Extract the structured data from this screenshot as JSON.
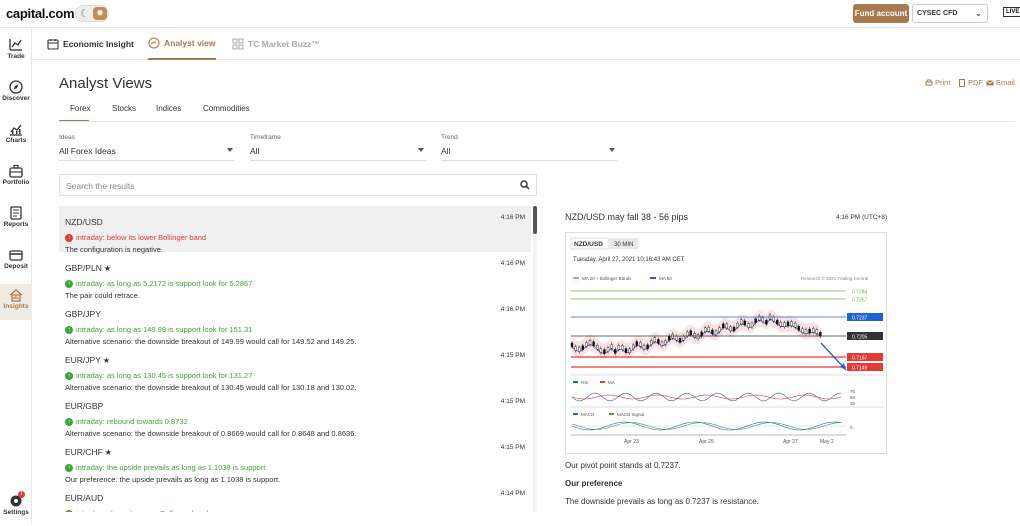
{
  "topbar": {
    "logo": "capital.com",
    "fund_button": "Fund account",
    "account": "CYSEC CFD",
    "live": "LIVE"
  },
  "sidebar": {
    "items": [
      {
        "label": "Trade",
        "icon": "trade-chart-icon"
      },
      {
        "label": "Discover",
        "icon": "compass-icon"
      },
      {
        "label": "Charts",
        "icon": "charts-icon"
      },
      {
        "label": "Portfolio",
        "icon": "briefcase-icon"
      },
      {
        "label": "Reports",
        "icon": "reports-icon"
      },
      {
        "label": "Deposit",
        "icon": "card-icon"
      },
      {
        "label": "Insights",
        "icon": "insights-icon"
      }
    ],
    "settings_label": "Settings",
    "settings_badge": "1"
  },
  "tabs": [
    {
      "label": "Economic Insight"
    },
    {
      "label": "Analyst view"
    },
    {
      "label": "TC Market Buzz™"
    }
  ],
  "page": {
    "title": "Analyst Views",
    "print": "Print",
    "pdf": "PDF",
    "email": "Email"
  },
  "subtabs": [
    "Forex",
    "Stocks",
    "Indices",
    "Commodities"
  ],
  "filters": [
    {
      "label": "Ideas",
      "value": "All Forex Ideas"
    },
    {
      "label": "Timeframe",
      "value": "All"
    },
    {
      "label": "Trend",
      "value": "All"
    }
  ],
  "search": {
    "placeholder": "Search the results"
  },
  "ideas": [
    {
      "pair": "NZD/USD",
      "star": "",
      "time": "4:16 PM",
      "dir": "down",
      "signal": "intraday: below its lower Bollinger band",
      "desc": "The configuration is negative."
    },
    {
      "pair": "GBP/PLN",
      "star": "★",
      "time": "4:16 PM",
      "dir": "up",
      "signal": "intraday: as long as 5.2172 is support look for 5.2867",
      "desc": "The pair could retrace."
    },
    {
      "pair": "GBP/JPY",
      "star": "",
      "time": "4:16 PM",
      "dir": "up",
      "signal": "intraday: as long as 149.99 is support look for 151.31",
      "desc": "Alternative scenario: the downside breakout of 149.99 would call for 149.52 and 149.25."
    },
    {
      "pair": "EUR/JPY",
      "star": "★",
      "time": "4:15 PM",
      "dir": "up",
      "signal": "intraday: as long as 130.45 is support look for 131.27",
      "desc": "Alternative scenario: the downside breakout of 130.45 would call for 130.18 and 130.02."
    },
    {
      "pair": "EUR/GBP",
      "star": "",
      "time": "4:15 PM",
      "dir": "up",
      "signal": "intraday: rebound towards 0.8732",
      "desc": "Alternative scenario: the downside breakout of 0.8669 would call for 0.8648 and 0.8636."
    },
    {
      "pair": "EUR/CHF",
      "star": "★",
      "time": "4:15 PM",
      "dir": "up",
      "signal": "intraday: the upside prevails as long as 1.1038 is support",
      "desc": "Our preference: the upside prevails as long as 1.1038 is support."
    },
    {
      "pair": "EUR/AUD",
      "star": "",
      "time": "4:14 PM",
      "dir": "up",
      "signal": "intraday: above its upper Bollinger band",
      "desc": ""
    }
  ],
  "detail": {
    "title": "NZD/USD may fall 38 - 56 pips",
    "time": "4:16 PM (UTC+8)",
    "pivot": "Our pivot point stands at 0.7237.",
    "pref_heading": "Our preference",
    "pref_text": "The downside prevails as long as 0.7237 is resistance."
  },
  "chart_data": {
    "type": "line",
    "symbol": "NZD/USD",
    "timeframe": "30 MIN",
    "date": "Tuesday, April 27, 2021 10:16:43 AM CET",
    "legend": [
      "MA 20 + Bollinger Bands",
      "MA 50"
    ],
    "credit": "Research © 2021 Trading Central",
    "levels": [
      {
        "value": "0.7284",
        "color": "#7cb342"
      },
      {
        "value": "0.7267",
        "color": "#7cb342"
      },
      {
        "value": "0.7237",
        "color": "#1e63d6"
      },
      {
        "value": "0.7205",
        "color": "#333333"
      },
      {
        "value": "0.7167",
        "color": "#e53935"
      },
      {
        "value": "0.7149",
        "color": "#e53935"
      }
    ],
    "rsi_legend": [
      "RSI",
      "MA"
    ],
    "rsi_ticks": [
      "70",
      "50",
      "30"
    ],
    "macd_legend": [
      "MACD",
      "MACD Signal"
    ],
    "macd_tick": "0",
    "x_ticks": [
      "Apr 23",
      "Apr 25",
      "Apr 27",
      "May 2"
    ]
  },
  "colors": {
    "accent": "#a9794e",
    "up": "#3fa535",
    "down": "#e53935"
  }
}
